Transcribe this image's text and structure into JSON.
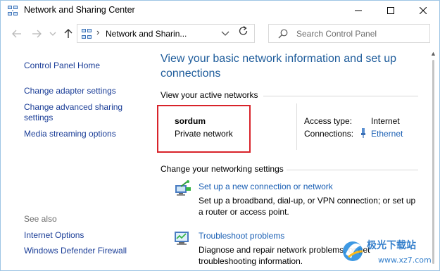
{
  "window": {
    "title": "Network and Sharing Center"
  },
  "address_bar": {
    "separator": "›",
    "path": "Network and Sharin...",
    "search_placeholder": "Search Control Panel"
  },
  "sidebar": {
    "home": "Control Panel Home",
    "links": [
      "Change adapter settings",
      "Change advanced sharing",
      "settings",
      "Media streaming options"
    ],
    "see_also_label": "See also",
    "see_also": [
      "Internet Options",
      "Windows Defender Firewall"
    ]
  },
  "main": {
    "title_line1": "View your basic network information and set up",
    "title_line2": "connections",
    "active_networks_label": "View your active networks",
    "network": {
      "name": "sordum",
      "type": "Private network"
    },
    "access_type_label": "Access type:",
    "access_type_value": "Internet",
    "connections_label": "Connections:",
    "connections_value": "Ethernet",
    "change_settings_label": "Change your networking settings",
    "tasks": [
      {
        "link": "Set up a new connection or network",
        "desc1": "Set up a broadband, dial-up, or VPN connection; or set up",
        "desc2": "a router or access point."
      },
      {
        "link": "Troubleshoot problems",
        "desc1": "Diagnose and repair network problems, or get",
        "desc2": "troubleshooting information."
      }
    ]
  },
  "watermark": {
    "brand": "极光下载站",
    "url": "www.xz7.com"
  },
  "colors": {
    "link": "#1a5fb4",
    "heading": "#1e5c9b",
    "highlight_box": "#d8232a"
  }
}
